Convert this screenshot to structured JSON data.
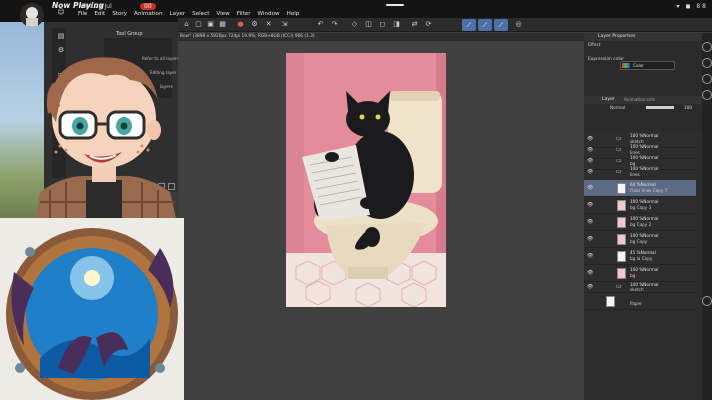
{
  "status": {
    "now_playing": "Now Playing",
    "date": "Wed 29 Jul",
    "time_badge": "00",
    "icons_text": "▾ ◼ 88"
  },
  "menu": {
    "items": [
      "File",
      "Edit",
      "Story",
      "Animation",
      "Layer",
      "Select",
      "View",
      "Filter",
      "Window",
      "Help"
    ]
  },
  "document_tab": {
    "label": "Bow* (3898 x 5920px 72dpi 19.9%, RGB+8GB (ICC)) 966 (1.3)"
  },
  "left_panel": {
    "subtool_title": "Tool Group",
    "option_refer": "Refer to all layers",
    "option_layer": "Editing layer only",
    "option_layers": "layers",
    "option_party": "party"
  },
  "right_panel": {
    "header": "Layer Properties",
    "effect_label": "Effect",
    "expression_label": "Expression color",
    "color_value": "Color",
    "layer_tab": "Layer",
    "layer_tab2": "Animation cels",
    "blend_mode": "Normal",
    "opacity": "100"
  },
  "layers": [
    {
      "line1": "100 %Normal",
      "line2": "sketch",
      "kind": "folder"
    },
    {
      "line1": "100 %Normal",
      "line2": "lines",
      "kind": "folder"
    },
    {
      "line1": "100 %Normal",
      "line2": "bg",
      "kind": "folder"
    },
    {
      "line1": "100 %Normal",
      "line2": "lines",
      "kind": "folder"
    },
    {
      "line1": "64 %Normal",
      "line2": "Floor lines Copy 7",
      "kind": "layer",
      "selected": true
    },
    {
      "line1": "100 %Normal",
      "line2": "bg Copy 3",
      "kind": "layer"
    },
    {
      "line1": "100 %Normal",
      "line2": "bg Copy 2",
      "kind": "layer"
    },
    {
      "line1": "100 %Normal",
      "line2": "bg Copy",
      "kind": "layer"
    },
    {
      "line1": "45 %Normal",
      "line2": "bg la Copy",
      "kind": "layer"
    },
    {
      "line1": "100 %Normal",
      "line2": "bg",
      "kind": "layer"
    },
    {
      "line1": "100 %Normal",
      "line2": "sketch",
      "kind": "folder"
    },
    {
      "line1": "",
      "line2": "Paper",
      "kind": "paper"
    }
  ],
  "colors": {
    "accent_blue": "#4f6fa7",
    "selected_row": "#5d6a86",
    "pink_wall": "#e58c9c",
    "cat_black": "#1b1b1d",
    "record_red": "#c4302b"
  }
}
